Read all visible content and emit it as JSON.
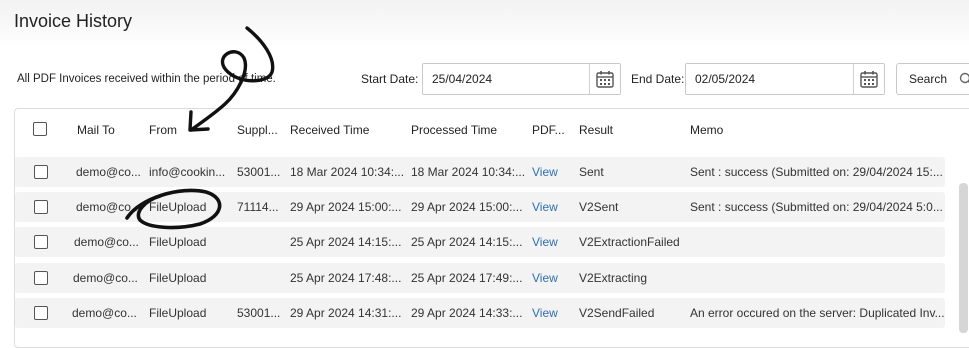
{
  "page": {
    "title": "Invoice History"
  },
  "filters": {
    "description": "All PDF Invoices received within the period of time.",
    "start_label": "Start Date:",
    "start_value": "25/04/2024",
    "end_label": "End Date:",
    "end_value": "02/05/2024",
    "search_label": "Search"
  },
  "table": {
    "columns": [
      "Mail To",
      "From",
      "Suppl...",
      "Received Time",
      "Processed Time",
      "PDF...",
      "Result",
      "Memo"
    ],
    "rows": [
      {
        "mail_to": "demo@co...",
        "from": "info@cookin...",
        "supplier": "53001...",
        "received": "18 Mar 2024 10:34:...",
        "processed": "18 Mar 2024 10:34:...",
        "pdf": "View",
        "result": "Sent",
        "memo": "Sent : success (Submitted on: 29/04/2024 15:..."
      },
      {
        "mail_to": "demo@co...",
        "from": "FileUpload",
        "supplier": "71114...",
        "received": "29 Apr 2024 15:00:...",
        "processed": "29 Apr 2024 15:00:...",
        "pdf": "View",
        "result": "V2Sent",
        "memo": "Sent : success (Submitted on: 29/04/2024 5:0..."
      },
      {
        "mail_to": "demo@co...",
        "from": "FileUpload",
        "supplier": "",
        "received": "25 Apr 2024 14:15:...",
        "processed": "25 Apr 2024 14:15:...",
        "pdf": "View",
        "result": "V2ExtractionFailed",
        "memo": ""
      },
      {
        "mail_to": "demo@co...",
        "from": "FileUpload",
        "supplier": "",
        "received": "25 Apr 2024 17:48:...",
        "processed": "25 Apr 2024 17:49:...",
        "pdf": "View",
        "result": "V2Extracting",
        "memo": ""
      },
      {
        "mail_to": "demo@co...",
        "from": "FileUpload",
        "supplier": "53001...",
        "received": "29 Apr 2024 14:31:...",
        "processed": "29 Apr 2024 14:33:...",
        "pdf": "View",
        "result": "V2SendFailed",
        "memo": "An error occured on the server: Duplicated Inv..."
      }
    ]
  },
  "colors": {
    "link": "#2f6fb0",
    "row_bg": "#f3f3f3"
  }
}
